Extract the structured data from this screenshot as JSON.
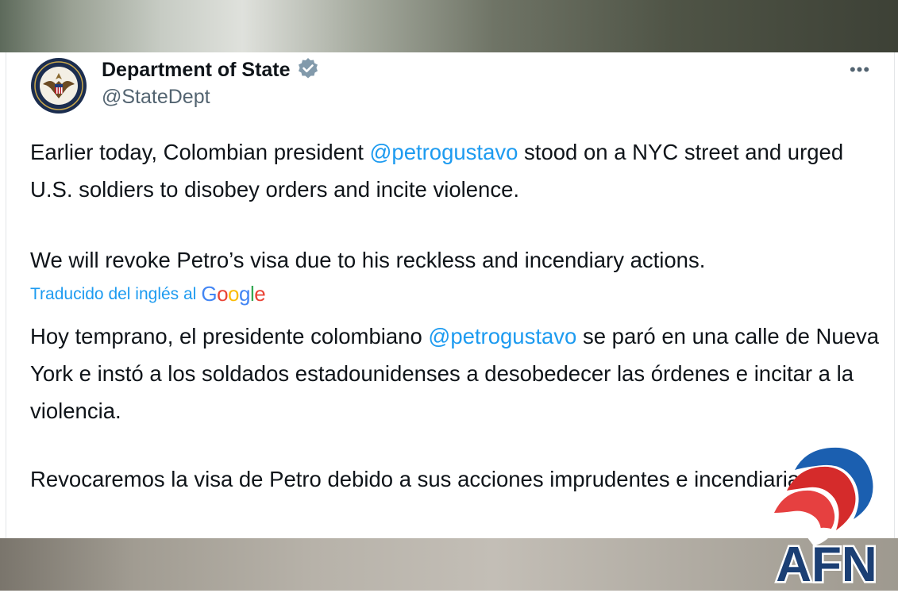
{
  "tweet": {
    "author": {
      "display_name": "Department of State",
      "handle": "@StateDept",
      "verified": true,
      "avatar_icon": "state-department-seal"
    },
    "more_label": "•••",
    "english": {
      "p1_before": "Earlier today, Colombian president ",
      "p1_mention": "@petrogustavo",
      "p1_after": " stood on a NYC street and urged U.S. soldiers to disobey orders and incite violence.",
      "p2": "We will revoke Petro’s visa due to his reckless and incendiary actions."
    },
    "translation": {
      "label": "Traducido del inglés al",
      "provider": "Google",
      "p1_before": "Hoy temprano, el presidente colombiano ",
      "p1_mention": "@petrogustavo",
      "p1_after": " se paró en una calle de Nueva York e instó a los soldados estadounidenses a desobedecer las órdenes e incitar a la violencia.",
      "p2": "Revocaremos la visa de Petro debido a sus acciones imprudentes e incendiarias."
    }
  },
  "watermark": {
    "text": "AFN"
  },
  "colors": {
    "link": "#1d9bf0",
    "text": "#0f1419",
    "muted": "#536471",
    "verified_badge": "#829aab"
  }
}
